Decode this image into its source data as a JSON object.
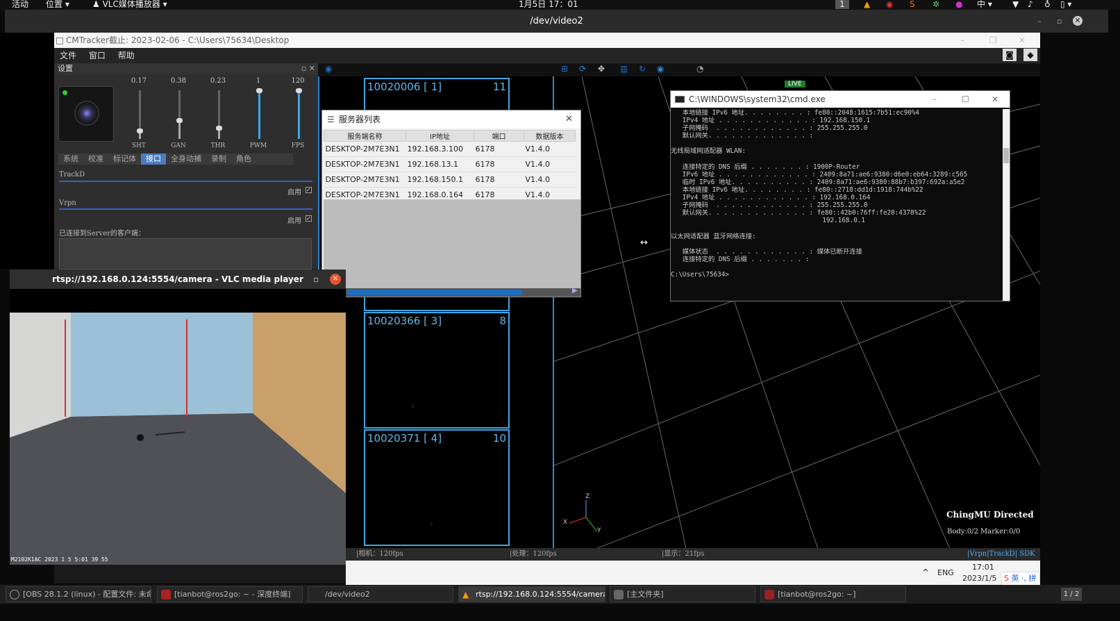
{
  "topbar": {
    "activities": "活动",
    "places": "位置",
    "app": "VLC媒体播放器",
    "clock": "1月5日 17：01",
    "workspace": "1",
    "ime": "中"
  },
  "window": {
    "title": "/dev/video2"
  },
  "cmtracker": {
    "title": "CMTracker截止: 2023-02-06 - C:\\Users\\75634\\Desktop",
    "menu": [
      "文件",
      "窗口",
      "帮助"
    ],
    "settings_title": "设置",
    "sliders": [
      {
        "value": "0.17",
        "label": "SHT",
        "level": 0.17
      },
      {
        "value": "0.38",
        "label": "GAN",
        "level": 0.38
      },
      {
        "value": "0.23",
        "label": "THR",
        "level": 0.23
      },
      {
        "value": "1",
        "label": "PWM",
        "level": 1
      },
      {
        "value": "120",
        "label": "FPS",
        "level": 1
      }
    ],
    "tabs": [
      "系统",
      "校准",
      "标记体",
      "接口",
      "全身动捕",
      "录制",
      "角色"
    ],
    "active_tab": "接口",
    "trackd_label": "TrackD",
    "vrpn_label": "Vrpn",
    "enable_label": "启用",
    "clients_label": "已连接到Server的客户端：",
    "cameras": [
      {
        "id": "10020006 [ 1]",
        "count": "11"
      },
      {
        "id": "10020366 [ 3]",
        "count": "8"
      },
      {
        "id": "10020371 [ 4]",
        "count": "10"
      }
    ],
    "live": "LIVE",
    "brand": "ChingMU Directed",
    "body_marker": "Body:0/2 Marker:0/0",
    "axes": {
      "z": "Z",
      "x": "X",
      "y": "Y"
    },
    "status": {
      "camera": "|相机：120fps",
      "process": "|处理：120fps",
      "display": "|显示：21fps",
      "vrpn": "Vrpn",
      "trackd": "TrackD",
      "sdk": "SDK"
    }
  },
  "server_dialog": {
    "title": "服务器列表",
    "headers": [
      "服务端名称",
      "IP地址",
      "端口",
      "数据版本"
    ],
    "rows": [
      [
        "DESKTOP-2M7E3N1",
        "192.168.3.100",
        "6178",
        "V1.4.0"
      ],
      [
        "DESKTOP-2M7E3N1",
        "192.168.13.1",
        "6178",
        "V1.4.0"
      ],
      [
        "DESKTOP-2M7E3N1",
        "192.168.150.1",
        "6178",
        "V1.4.0"
      ],
      [
        "DESKTOP-2M7E3N1",
        "192.168.0.164",
        "6178",
        "V1.4.0"
      ]
    ]
  },
  "cmd": {
    "title": "C:\\WINDOWS\\system32\\cmd.exe",
    "lines": [
      "   本地链接 IPv6 地址. . . . . . . . : fe80::2048:1615:7b51:ec90%4",
      "   IPv4 地址 . . . . . . . . . . . . : 192.168.150.1",
      "   子网掩码  . . . . . . . . . . . . : 255.255.255.0",
      "   默认网关. . . . . . . . . . . . . :",
      "",
      "无线局域网适配器 WLAN:",
      "",
      "   连接特定的 DNS 后缀 . . . . . . . : 1900P-Router",
      "   IPv6 地址 . . . . . . . . . . . . : 2409:8a71:ae6:9380:d6e0:eb64:3289:c565",
      "   临时 IPv6 地址. . . . . . . . . . : 2409:8a71:ae6:9380:88b7:b397:692a:a5e2",
      "   本地链接 IPv6 地址. . . . . . . . : fe80::2718:dd1d:1918:744b%22",
      "   IPv4 地址 . . . . . . . . . . . . : 192.168.0.164",
      "   子网掩码  . . . . . . . . . . . . : 255.255.255.0",
      "   默认网关. . . . . . . . . . . . . : fe80::42b0:76ff:fe20:4378%22",
      "                                       192.168.0.1",
      "",
      "以太网适配器 蓝牙网络连接:",
      "",
      "   媒体状态  . . . . . . . . . . . . : 媒体已断开连接",
      "   连接特定的 DNS 后缀 . . . . . . . :",
      "",
      "C:\\Users\\75634>"
    ]
  },
  "vlc": {
    "title": "rtsp://192.168.0.124:5554/camera - VLC media player",
    "overlay": "M2102K1AC 2023 1 5   5:01 39 55"
  },
  "tray": {
    "lang": "ENG",
    "time": "17:01",
    "date": "2023/1/5",
    "ime": "英 ·, 拼"
  },
  "taskbar": [
    {
      "label": "[OBS 28.1.2 (linux) - 配置文件: 未命..."
    },
    {
      "label": "[tianbot@ros2go: ~ - 深度终端]"
    },
    {
      "label": "/dev/video2"
    },
    {
      "label": "rtsp://192.168.0.124:5554/camera..."
    },
    {
      "label": "[主文件夹]"
    },
    {
      "label": "[tianbot@ros2go: ~]"
    }
  ],
  "pager": "1 / 2"
}
